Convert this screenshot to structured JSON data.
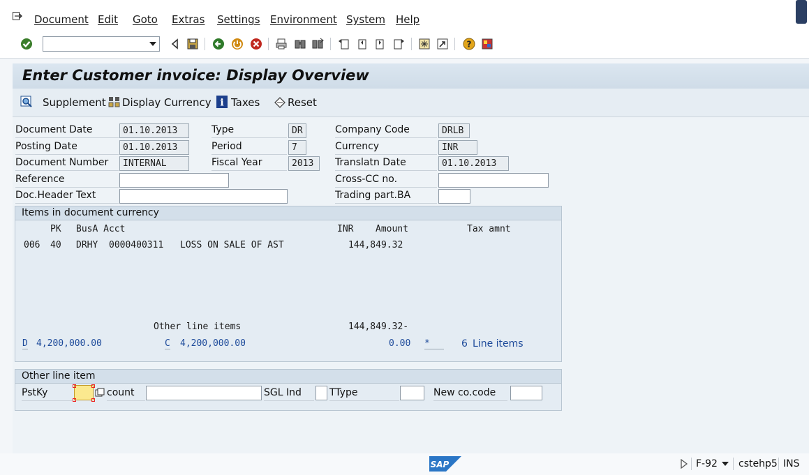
{
  "menu": [
    "Document",
    "Edit",
    "Goto",
    "Extras",
    "Settings",
    "Environment",
    "System",
    "Help"
  ],
  "toolbar": {
    "command_value": "",
    "icons": [
      "enter-icon",
      "back-icon",
      "save-icon",
      "back-green-icon",
      "exit-icon",
      "cancel-icon",
      "print-icon",
      "find-icon",
      "find-next-icon",
      "first-page-icon",
      "prev-page-icon",
      "next-page-icon",
      "last-page-icon",
      "create-session-icon",
      "shortcut-icon",
      "help-icon",
      "customize-layout-icon"
    ]
  },
  "title": "Enter Customer invoice: Display Overview",
  "app_toolbar": {
    "supplement": "Supplement",
    "display_currency": "Display Currency",
    "taxes": "Taxes",
    "reset": "Reset"
  },
  "header": {
    "document_date": {
      "label": "Document Date",
      "value": "01.10.2013"
    },
    "posting_date": {
      "label": "Posting Date",
      "value": "01.10.2013"
    },
    "document_number": {
      "label": "Document Number",
      "value": "INTERNAL"
    },
    "reference": {
      "label": "Reference",
      "value": ""
    },
    "doc_header_text": {
      "label": "Doc.Header Text",
      "value": ""
    },
    "type": {
      "label": "Type",
      "value": "DR"
    },
    "period": {
      "label": "Period",
      "value": "7"
    },
    "fiscal_year": {
      "label": "Fiscal Year",
      "value": "2013"
    },
    "company_code": {
      "label": "Company Code",
      "value": "DRLB"
    },
    "currency": {
      "label": "Currency",
      "value": "INR"
    },
    "translatn_date": {
      "label": "Translatn Date",
      "value": "01.10.2013"
    },
    "cross_cc": {
      "label": "Cross-CC no.",
      "value": ""
    },
    "trading_part": {
      "label": "Trading part.BA",
      "value": ""
    }
  },
  "items": {
    "title": "Items in document currency",
    "col_pk": "PK",
    "col_busa_acct": "BusA Acct",
    "col_currency": "INR",
    "col_amount": "Amount",
    "col_tax": "Tax amnt",
    "row": {
      "no": "006",
      "pk": "40",
      "busa": "DRHY",
      "acct": "0000400311",
      "desc": "LOSS ON SALE OF AST",
      "amount": "144,849.32"
    },
    "other_label": "Other line items",
    "other_amount": "144,849.32-",
    "debit_prefix": "D",
    "debit": "4,200,000.00",
    "credit_prefix": "C",
    "credit": "4,200,000.00",
    "balance": "0.00",
    "balance_mark": "*",
    "line_items_count": "6",
    "line_items_label": "Line items"
  },
  "other_line": {
    "title": "Other line item",
    "pstky": "PstKy",
    "pstky_value": "",
    "account": "count",
    "account_value": "",
    "sgl_ind": "SGL Ind",
    "ttype": "TType",
    "new_co_code": "New co.code"
  },
  "status": {
    "transaction": "F-92",
    "server": "cstehp5",
    "mode": "INS",
    "logo": "SAP"
  }
}
